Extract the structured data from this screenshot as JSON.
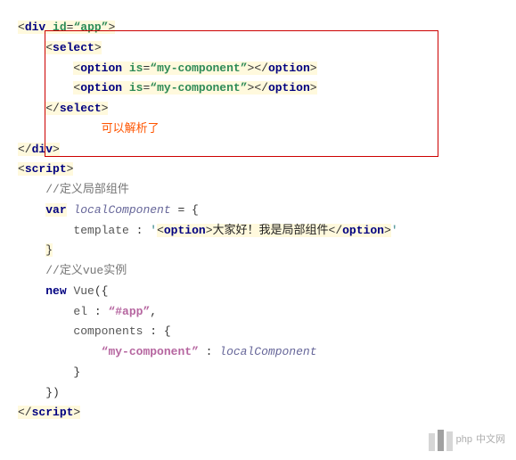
{
  "lines": {
    "l1": {
      "open": "<",
      "div": "div",
      "sp": " ",
      "id": "id",
      "eq": "=",
      "q1": "“",
      "app": "app",
      "q2": "”",
      "close": ">"
    },
    "l2": {
      "open": "<",
      "select": "select",
      "close": ">"
    },
    "l3": {
      "open": "<",
      "option": "option",
      "sp": " ",
      "is": "is",
      "eq": "=",
      "q1": "“",
      "mc": "my-component",
      "q2": "”",
      "mid": "></",
      "close": ">"
    },
    "l4": {
      "open": "<",
      "option": "option",
      "sp": " ",
      "is": "is",
      "eq": "=",
      "q1": "“",
      "mc": "my-component",
      "q2": "”",
      "mid": "></",
      "close": ">"
    },
    "l5": {
      "open": "</",
      "select": "select",
      "close": ">"
    },
    "l6": {
      "text": "可以解析了"
    },
    "l7": {
      "open": "</",
      "div": "div",
      "close": ">"
    },
    "l8": {
      "open": "<",
      "script": "script",
      "close": ">"
    },
    "l9": {
      "text": "//定义局部组件"
    },
    "l10": {
      "var": "var",
      "sp": " ",
      "name": "localComponent",
      "eq": " = {"
    },
    "l11": {
      "prop": "template",
      "colon": " : ",
      "q": "'",
      "open": "<",
      "option": "option",
      "close": ">",
      "cn": "大家好！我是局部组件",
      "open2": "</",
      "option2": "option",
      "close2": ">",
      "q2": "'"
    },
    "l12": {
      "text": "}"
    },
    "l13": {
      "text": "//定义vue实例"
    },
    "l14": {
      "new": "new",
      "vue": "Vue",
      "paren": "({"
    },
    "l15": {
      "prop": "el",
      "colon": " : ",
      "q1": "“",
      "val": "#app",
      "q2": "”",
      "comma": ","
    },
    "l16": {
      "prop": "components",
      "colon": " : {"
    },
    "l17": {
      "q1": "“",
      "key": "my-component",
      "q2": "”",
      "colon": " : ",
      "val": "localComponent"
    },
    "l18": {
      "text": "}"
    },
    "l19": {
      "text": "})"
    },
    "l20": {
      "open": "</",
      "script": "script",
      "close": ">"
    }
  },
  "annotation": "可以解析了",
  "watermark": {
    "php": "php",
    "cn": "中文网"
  }
}
